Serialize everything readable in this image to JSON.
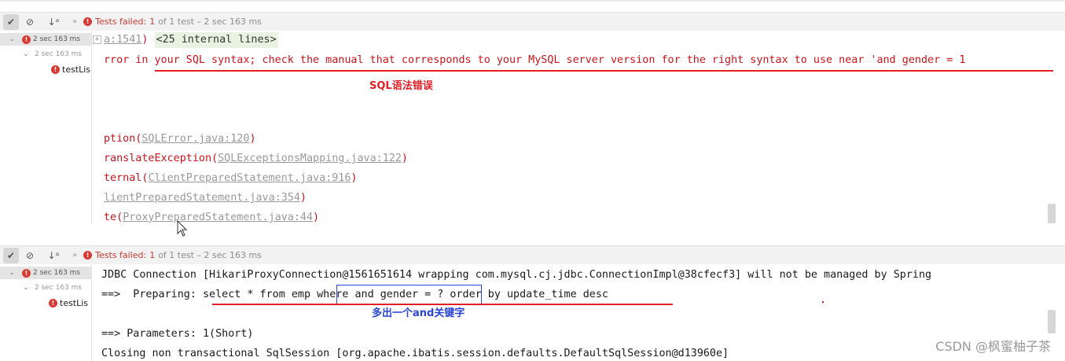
{
  "panels": [
    {
      "toolbar": {
        "status_fail": "Tests failed:",
        "status_count": "1",
        "status_rest": "of 1 test – 2 sec 163 ms"
      },
      "tree": {
        "root_time": "2 sec 163 ms",
        "child_time": "2 sec 163 ms",
        "leaf_name": "testLis"
      }
    },
    {
      "toolbar": {
        "status_fail": "Tests failed:",
        "status_count": "1",
        "status_rest": "of 1 test – 2 sec 163 ms"
      },
      "tree": {
        "root_time": "2 sec 163 ms",
        "child_time": "2 sec 163 ms",
        "leaf_name": "testLis"
      }
    }
  ],
  "console1": {
    "line0_prefix": "a:1541",
    "line0_paren": ")",
    "line0_fold": "<25 internal lines>",
    "line1": "rror in your SQL syntax; check the manual that corresponds to your MySQL server version for the right syntax to use near 'and gender = 1",
    "annotation": "SQL语法错误",
    "line2_pre": "ption(",
    "line2_link": "SQLError.java:120",
    "line2_post": ")",
    "line3_pre": "ranslateException(",
    "line3_link": "SQLExceptionsMapping.java:122",
    "line3_post": ")",
    "line4_pre": "ternal(",
    "line4_link": "ClientPreparedStatement.java:916",
    "line4_post": ")",
    "line5_link": "lientPreparedStatement.java:354",
    "line5_post": ")",
    "line6_pre": "te(",
    "line6_link": "ProxyPreparedStatement.java:44",
    "line6_post": ")"
  },
  "console2": {
    "line1": "JDBC Connection [HikariProxyConnection@1561651614 wrapping com.mysql.cj.jdbc.ConnectionImpl@38cfecf3] will not be managed by Spring",
    "line2_a": "==>  Preparing: select * from emp ",
    "line2_box": "where and gender = ?",
    "line2_b": " order by update_time desc",
    "annotation": "多出一个and关键字",
    "line3": "==> Parameters: 1(Short)",
    "line4": "Closing non transactional SqlSession [org.apache.ibatis.session.defaults.DefaultSqlSession@d13960e]"
  },
  "watermark": "CSDN @枫蜜柚子茶",
  "colors": {
    "error_red": "#c9141c",
    "annotation_red": "#e31e24",
    "annotation_blue": "#2a45d6",
    "fold_bg": "#e7f3e0"
  },
  "icons": [
    "check-icon",
    "stop-icon",
    "sort-icon",
    "more-icon",
    "error-icon",
    "chevron-down-icon",
    "mouse-cursor-icon"
  ]
}
